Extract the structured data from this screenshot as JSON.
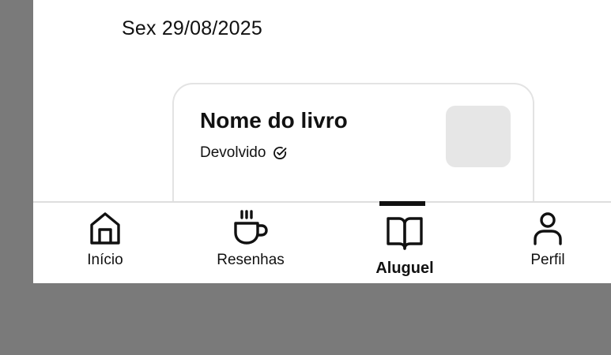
{
  "date_label": "Sex 29/08/2025",
  "rental_card": {
    "title": "Nome do livro",
    "status": "Devolvido",
    "status_icon": "check-circle-icon"
  },
  "nav": {
    "items": [
      {
        "label": "Início",
        "icon": "home-icon",
        "active": false
      },
      {
        "label": "Resenhas",
        "icon": "coffee-icon",
        "active": false
      },
      {
        "label": "Aluguel",
        "icon": "book-open-icon",
        "active": true
      },
      {
        "label": "Perfil",
        "icon": "user-icon",
        "active": false
      }
    ]
  },
  "colors": {
    "background_frame": "#7a7a7a",
    "screen": "#ffffff",
    "thumbnail": "#e6e6e6",
    "text": "#111111"
  }
}
